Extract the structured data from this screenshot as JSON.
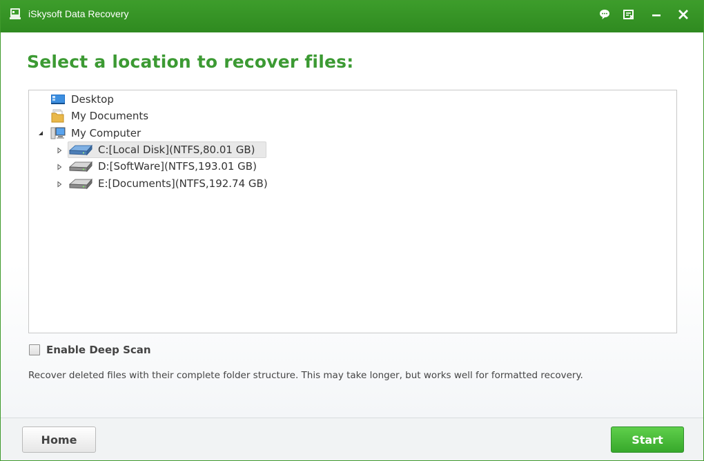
{
  "window": {
    "title": "iSkysoft Data Recovery"
  },
  "titlebar": {
    "buttons": [
      "feedback-icon",
      "register-icon",
      "minimize-icon",
      "close-icon"
    ]
  },
  "main": {
    "heading": "Select a location to recover files:",
    "tree": {
      "desktop": {
        "label": "Desktop",
        "icon": "desktop-icon"
      },
      "my_documents": {
        "label": "My Documents",
        "icon": "documents-folder-icon"
      },
      "my_computer": {
        "label": "My Computer",
        "icon": "computer-icon",
        "expanded": true,
        "drives": [
          {
            "label": "C:[Local Disk](NTFS,80.01 GB)",
            "selected": true,
            "icon": "hard-drive-icon"
          },
          {
            "label": "D:[SoftWare](NTFS,193.01 GB)",
            "selected": false,
            "icon": "hard-drive-icon"
          },
          {
            "label": "E:[Documents](NTFS,192.74 GB)",
            "selected": false,
            "icon": "hard-drive-icon"
          }
        ]
      }
    },
    "deep_scan": {
      "label": "Enable Deep Scan",
      "checked": false
    },
    "description": "Recover deleted files with their complete folder structure. This may take longer, but works well for formatted recovery."
  },
  "footer": {
    "home_label": "Home",
    "start_label": "Start"
  },
  "colors": {
    "brand_green": "#3c9a33",
    "titlebar_green": "#36932a",
    "start_button": "#45b83a"
  }
}
